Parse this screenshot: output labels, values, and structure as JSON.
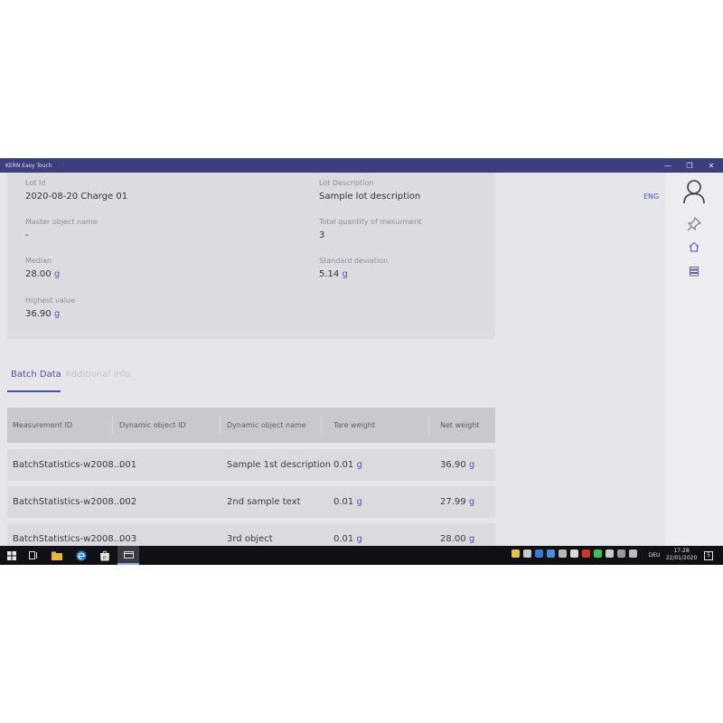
{
  "window": {
    "title": "KERN Easy Touch",
    "minimize_glyph": "—",
    "maximize_glyph": "❐",
    "close_glyph": "✕"
  },
  "lot": {
    "lot_id": {
      "label": "Lot Id",
      "value": "2020-08-20 Charge 01"
    },
    "lot_description": {
      "label": "Lot Description",
      "value": "Sample lot description"
    },
    "master_object_name": {
      "label": "Master object name",
      "value": "-"
    },
    "total_quantity": {
      "label": "Total quantity of mesurment",
      "value": "3"
    },
    "median": {
      "label": "Median",
      "value": "28.00",
      "unit": "g"
    },
    "standard_deviation": {
      "label": "Standard deviation",
      "value": "5.14",
      "unit": "g"
    },
    "highest_value": {
      "label": "Highest value",
      "value": "36.90",
      "unit": "g"
    }
  },
  "language": "ENG",
  "tabs": [
    {
      "label": "Batch Data",
      "active": true
    },
    {
      "label": "Additional Info.",
      "active": false
    }
  ],
  "table": {
    "columns": [
      "Measurement ID",
      "Dynamic object ID",
      "Dynamic object name",
      "Tare weight",
      "Net weight"
    ],
    "rows": [
      {
        "measurement_id": "BatchStatistics-w2008...",
        "object_id": "001",
        "object_name": "Sample 1st description",
        "tare": "0.01",
        "tare_unit": "g",
        "net": "36.90",
        "net_unit": "g"
      },
      {
        "measurement_id": "BatchStatistics-w2008...",
        "object_id": "002",
        "object_name": "2nd sample text",
        "tare": "0.01",
        "tare_unit": "g",
        "net": "27.99",
        "net_unit": "g"
      },
      {
        "measurement_id": "BatchStatistics-w2008...",
        "object_id": "003",
        "object_name": "3rd object",
        "tare": "0.01",
        "tare_unit": "g",
        "net": "28.00",
        "net_unit": "g"
      }
    ]
  },
  "right_nav": {
    "icons": [
      "user-icon",
      "pin-icon",
      "home-icon",
      "list-icon"
    ]
  },
  "taskbar": {
    "apps": [
      "start-icon",
      "task-view-icon",
      "file-explorer-icon",
      "edge-icon",
      "store-icon",
      "kern-app-icon"
    ],
    "language": "DEU",
    "time": "17:28",
    "date": "22/01/2020",
    "notification_count": "5"
  },
  "colors": {
    "titlebar": "#3c3e7e",
    "accent": "#4a50a8",
    "unit": "#4b55b5"
  }
}
